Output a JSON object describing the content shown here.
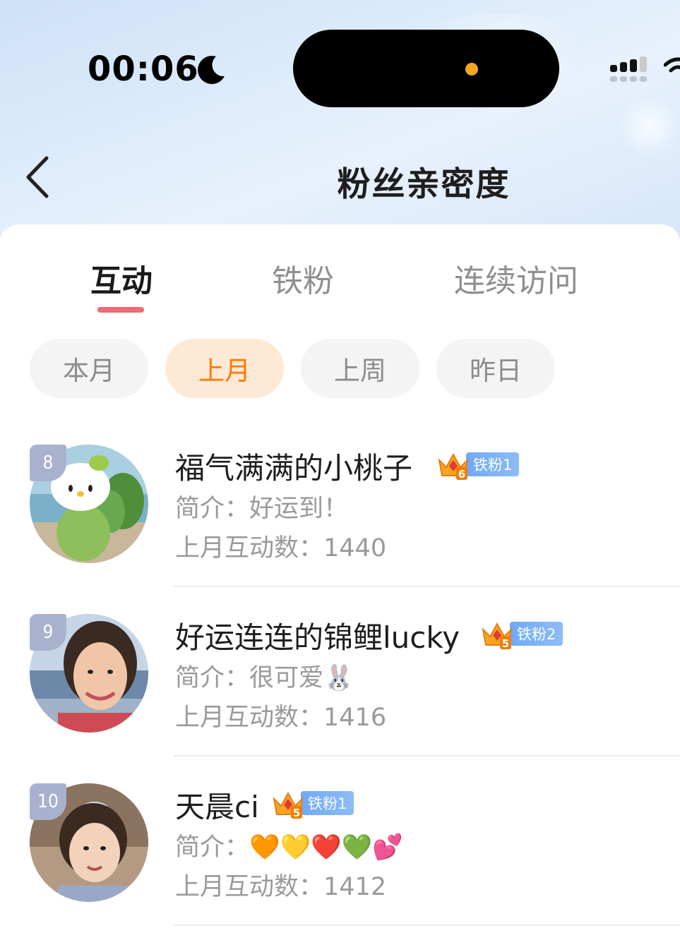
{
  "status_bar": {
    "time": "00:06"
  },
  "nav": {
    "title": "粉丝亲密度"
  },
  "tabs": [
    {
      "label": "互动",
      "active": true
    },
    {
      "label": "铁粉",
      "active": false
    },
    {
      "label": "连续访问",
      "active": false
    }
  ],
  "periods": [
    {
      "label": "本月",
      "active": false
    },
    {
      "label": "上月",
      "active": true
    },
    {
      "label": "上周",
      "active": false
    },
    {
      "label": "昨日",
      "active": false
    }
  ],
  "fans": [
    {
      "rank": "8",
      "name": "福气满满的小桃子",
      "crown_level": "6",
      "fan_badge": "铁粉1",
      "bio_prefix": "简介：",
      "bio": "好运到！",
      "count_label": "上月互动数：",
      "count": "1440"
    },
    {
      "rank": "9",
      "name": "好运连连的锦鲤lucky",
      "crown_level": "5",
      "fan_badge": "铁粉2",
      "bio_prefix": "简介：",
      "bio": "很可爱🐰",
      "count_label": "上月互动数：",
      "count": "1416"
    },
    {
      "rank": "10",
      "name": "天晨ci",
      "crown_level": "5",
      "fan_badge": "铁粉1",
      "bio_prefix": "简介：",
      "bio": "🧡💛❤️💚💕",
      "count_label": "上月互动数：",
      "count": "1412"
    }
  ],
  "colors": {
    "accent_orange": "#ff7a00",
    "tab_indicator": "#f06a73",
    "fan_badge_blue": "#7fb2f7",
    "rank_badge": "#a8b2cf"
  }
}
